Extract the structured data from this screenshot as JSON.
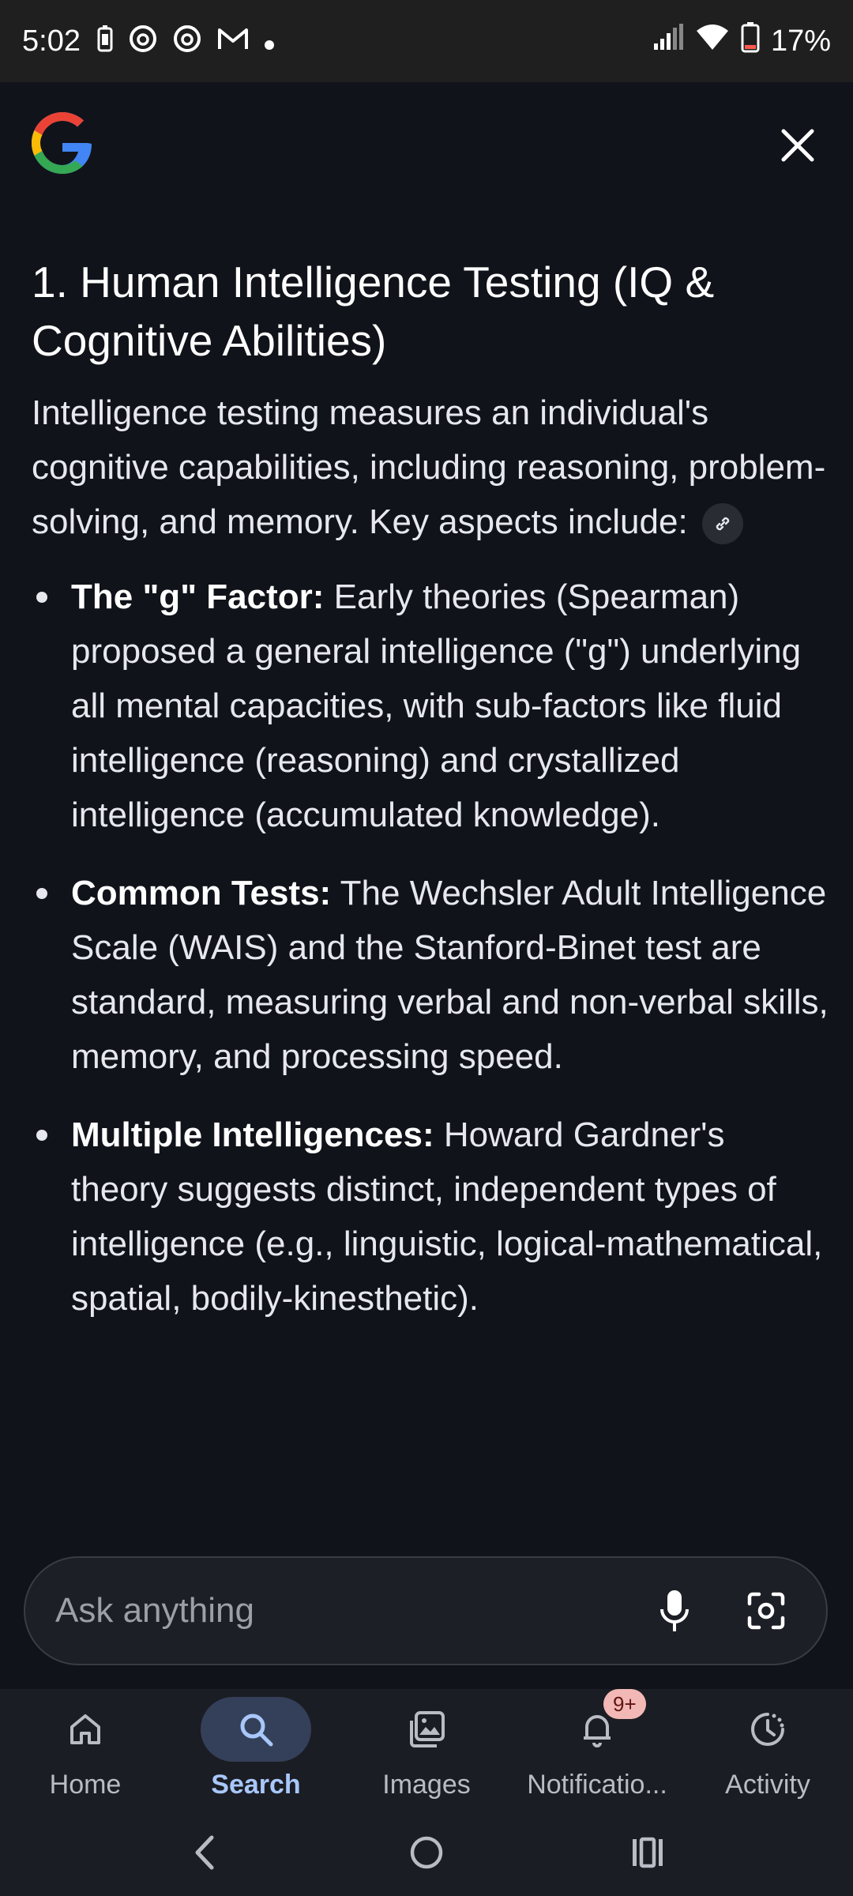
{
  "status_bar": {
    "time": "5:02",
    "battery": "17%",
    "icons": [
      "battery-saver-icon",
      "threads-icon",
      "threads-icon",
      "gmail-icon",
      "dot-icon"
    ],
    "right_icons": [
      "signal-icon",
      "wifi-icon",
      "battery-icon"
    ]
  },
  "header": {
    "logo_icon": "google-logo-icon",
    "close_icon": "close-icon"
  },
  "article": {
    "heading": "1. Human Intelligence Testing (IQ & Cognitive Abilities)",
    "intro": "Intelligence testing measures an individual's cognitive capabilities, including reasoning, problem-solving, and memory. Key aspects include:",
    "items": [
      {
        "title": "The \"g\" Factor:",
        "text": " Early theories (Spearman) proposed a general intelligence (\"g\") underlying all mental capacities, with sub-factors like fluid intelligence (reasoning) and crystallized intelligence (accumulated knowledge)."
      },
      {
        "title": "Common Tests:",
        "text": " The Wechsler Adult Intelligence Scale (WAIS) and the Stanford-Binet test are standard, measuring verbal and non-verbal skills, memory, and processing speed."
      },
      {
        "title": "Multiple Intelligences:",
        "text": " Howard Gardner's theory suggests distinct, independent types of intelligence (e.g., linguistic, logical-mathematical, spatial, bodily-kinesthetic)."
      }
    ]
  },
  "ask": {
    "placeholder": "Ask anything",
    "mic_icon": "mic-icon",
    "lens_icon": "lens-camera-icon"
  },
  "nav": {
    "items": [
      {
        "label": "Home",
        "icon": "home-icon"
      },
      {
        "label": "Search",
        "icon": "search-icon",
        "active": true
      },
      {
        "label": "Images",
        "icon": "images-icon"
      },
      {
        "label": "Notificatio...",
        "icon": "bell-icon",
        "badge": "9+"
      },
      {
        "label": "Activity",
        "icon": "activity-icon"
      }
    ]
  },
  "colors": {
    "background": "#11131a",
    "active_nav": "#a8c7fa",
    "badge": "#f2b8b5"
  }
}
